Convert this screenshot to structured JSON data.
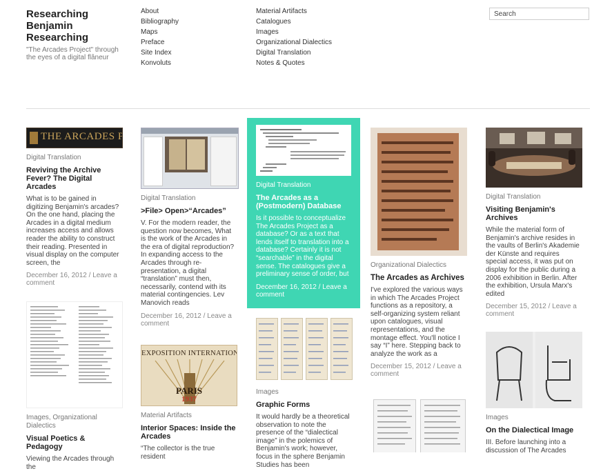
{
  "header": {
    "title": "Researching Benjamin Researching",
    "tagline": "\"The Arcades Project\" through the eyes of a digital flâneur"
  },
  "menu_primary": [
    "About",
    "Bibliography",
    "Maps",
    "Preface",
    "Site Index",
    "Konvoluts"
  ],
  "menu_secondary": [
    "Material Artifacts",
    "Catalogues",
    "Images",
    "Organizational Dialectics",
    "Digital Translation",
    "Notes & Quotes"
  ],
  "search": {
    "placeholder": "Search"
  },
  "posts": [
    {
      "thumb_text": "THE ARCADES PROJECT",
      "category": "Digital Translation",
      "title": "Reviving the Archive Fever? The Digital Arcades",
      "excerpt": "What is to be gained in digitizing Benjamin's arcades? On the one hand, placing the Arcades in a digital medium increases access and allows reader the ability to construct their reading. Presented in visual display on the computer screen, the",
      "date": "December 16, 2012",
      "comment": "Leave a comment"
    },
    {
      "category": "Digital Translation",
      "title": ">File> Open>“Arcades”",
      "excerpt": "V. For the modern reader, the question now becomes, What is the work of the Arcades in the era of digital reproduction? In expanding access to the Arcades through re-presentation, a digital “translation” must then, necessarily, contend with its material contingencies. Lev Manovich reads",
      "date": "December 16, 2012",
      "comment": "Leave a comment"
    },
    {
      "category": "Digital Translation",
      "title": "The Arcades as a (Postmodern) Database",
      "excerpt": "Is it possible to conceptualize The Arcades Project as a database? Or as a text that lends itself to translation into a database? Certainly it is not “searchable” in the digital sense. The catalogues give a preliminary sense of order, but",
      "date": "December 16, 2012",
      "comment": "Leave a comment"
    },
    {
      "category": "Organizational Dialectics",
      "title": "The Arcades as Archives",
      "excerpt": "I've explored the various ways in which The Arcades Project functions as a repository, a self-organizing system reliant upon catalogues, visual representations, and the montage effect.  You'll notice I say “I” here. Stepping back to analyze the work as a",
      "date": "December 15, 2012",
      "comment": "Leave a comment"
    },
    {
      "category": "Digital Translation",
      "title": "Visiting Benjamin's Archives",
      "excerpt": "While the material form of Benjamin's archive resides in the vaults of Berlin's Akademie der Künste and requires special access, it was put on display for the public during a 2006 exhibition in Berlin. After the exhibition, Ursula Marx's edited",
      "date": "December 15, 2012",
      "comment": "Leave a comment"
    },
    {
      "category_a": "Images",
      "category_b": "Organizational Dialectics",
      "title": "Visual Poetics & Pedagogy",
      "excerpt": "Viewing the Arcades through the"
    },
    {
      "thumb_text_1": "EXPOSITION INTERNATIONALE",
      "thumb_text_2": "PARIS",
      "thumb_text_3": "1937",
      "category": "Material Artifacts",
      "title": "Interior Spaces: Inside the Arcades",
      "excerpt": "“The collector is the true resident"
    },
    {
      "category": "Images",
      "title": "Graphic Forms",
      "excerpt": "It would hardly be a theoretical observation to note the presence of the “dialectical image” in the polemics of Benjamin's work; however, focus in the sphere Benjamin Studies has been"
    },
    {
      "category": "Images",
      "title": "On the Dialectical Image",
      "excerpt": "III. Before launching into a discussion of The Arcades"
    }
  ]
}
